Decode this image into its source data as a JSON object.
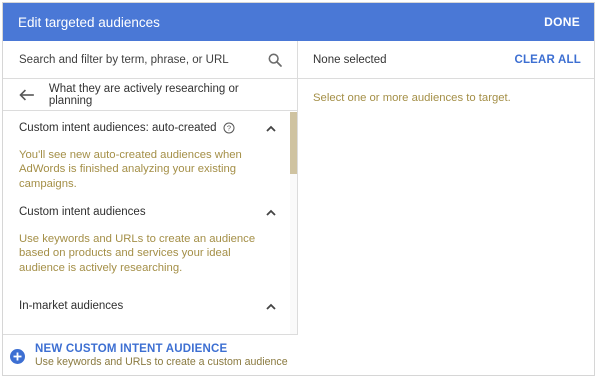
{
  "header": {
    "title": "Edit targeted audiences",
    "done_label": "DONE"
  },
  "search": {
    "placeholder": "Search and filter by term, phrase, or URL",
    "icon": "search-icon"
  },
  "nav": {
    "label": "What they are actively researching or planning",
    "icon": "arrow-back-icon"
  },
  "sections": [
    {
      "title": "Custom intent audiences: auto-created",
      "help_icon": "help-circle-icon",
      "description": "You'll see new auto-created audiences when AdWords is finished analyzing your existing campaigns."
    },
    {
      "title": "Custom intent audiences",
      "description": "Use keywords and URLs to create an audience based on products and services your ideal audience is actively researching."
    },
    {
      "title": "In-market audiences",
      "description": ""
    }
  ],
  "new_audience": {
    "title": "NEW CUSTOM INTENT AUDIENCE",
    "subtitle": "Use keywords and URLs to create a custom audience"
  },
  "selection": {
    "status": "None selected",
    "clear_label": "CLEAR ALL",
    "hint": "Select one or more audiences to target."
  },
  "colors": {
    "header_bg": "#4a78d6",
    "accent": "#3d6fd2",
    "description_text": "#a48f47",
    "scroll_thumb": "#cfc3a1"
  }
}
